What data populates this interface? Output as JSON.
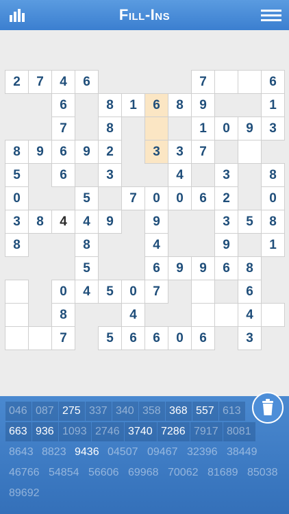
{
  "header": {
    "title": "Fill-Ins",
    "stats_icon": "bar-chart-icon",
    "menu_icon": "hamburger-menu-icon"
  },
  "colors": {
    "header": "#3b7fd0",
    "tray": "#3a79c4",
    "digit": "#1f4e7a",
    "highlight": "#fbe6c4"
  },
  "grid": {
    "rows": 12,
    "cols": 12,
    "cells": [
      {
        "r": 0,
        "c": 0,
        "v": "2"
      },
      {
        "r": 0,
        "c": 1,
        "v": "7"
      },
      {
        "r": 0,
        "c": 2,
        "v": "4"
      },
      {
        "r": 0,
        "c": 3,
        "v": "6"
      },
      {
        "r": 0,
        "c": 8,
        "v": "7"
      },
      {
        "r": 0,
        "c": 9,
        "v": ""
      },
      {
        "r": 0,
        "c": 10,
        "v": ""
      },
      {
        "r": 0,
        "c": 11,
        "v": "6"
      },
      {
        "r": 1,
        "c": 2,
        "v": "6"
      },
      {
        "r": 1,
        "c": 4,
        "v": "8"
      },
      {
        "r": 1,
        "c": 5,
        "v": "1"
      },
      {
        "r": 1,
        "c": 6,
        "v": "6",
        "hl": true
      },
      {
        "r": 1,
        "c": 7,
        "v": "8"
      },
      {
        "r": 1,
        "c": 8,
        "v": "9"
      },
      {
        "r": 1,
        "c": 11,
        "v": "1"
      },
      {
        "r": 2,
        "c": 2,
        "v": "7"
      },
      {
        "r": 2,
        "c": 4,
        "v": "8"
      },
      {
        "r": 2,
        "c": 6,
        "v": "",
        "hl": true
      },
      {
        "r": 2,
        "c": 8,
        "v": "1"
      },
      {
        "r": 2,
        "c": 9,
        "v": "0"
      },
      {
        "r": 2,
        "c": 10,
        "v": "9"
      },
      {
        "r": 2,
        "c": 11,
        "v": "3"
      },
      {
        "r": 3,
        "c": 0,
        "v": "8"
      },
      {
        "r": 3,
        "c": 1,
        "v": "9"
      },
      {
        "r": 3,
        "c": 2,
        "v": "6"
      },
      {
        "r": 3,
        "c": 3,
        "v": "9"
      },
      {
        "r": 3,
        "c": 4,
        "v": "2"
      },
      {
        "r": 3,
        "c": 6,
        "v": "3",
        "hl": true
      },
      {
        "r": 3,
        "c": 7,
        "v": "3"
      },
      {
        "r": 3,
        "c": 8,
        "v": "7"
      },
      {
        "r": 3,
        "c": 10,
        "v": ""
      },
      {
        "r": 4,
        "c": 0,
        "v": "5"
      },
      {
        "r": 4,
        "c": 2,
        "v": "6"
      },
      {
        "r": 4,
        "c": 4,
        "v": "3"
      },
      {
        "r": 4,
        "c": 7,
        "v": "4"
      },
      {
        "r": 4,
        "c": 9,
        "v": "3"
      },
      {
        "r": 4,
        "c": 11,
        "v": "8"
      },
      {
        "r": 5,
        "c": 0,
        "v": "0"
      },
      {
        "r": 5,
        "c": 3,
        "v": "5"
      },
      {
        "r": 5,
        "c": 5,
        "v": "7"
      },
      {
        "r": 5,
        "c": 6,
        "v": "0"
      },
      {
        "r": 5,
        "c": 7,
        "v": "0"
      },
      {
        "r": 5,
        "c": 8,
        "v": "6"
      },
      {
        "r": 5,
        "c": 9,
        "v": "2"
      },
      {
        "r": 5,
        "c": 11,
        "v": "0"
      },
      {
        "r": 6,
        "c": 0,
        "v": "3"
      },
      {
        "r": 6,
        "c": 1,
        "v": "8"
      },
      {
        "r": 6,
        "c": 2,
        "v": "4",
        "given": true
      },
      {
        "r": 6,
        "c": 3,
        "v": "4"
      },
      {
        "r": 6,
        "c": 4,
        "v": "9"
      },
      {
        "r": 6,
        "c": 6,
        "v": "9"
      },
      {
        "r": 6,
        "c": 9,
        "v": "3"
      },
      {
        "r": 6,
        "c": 10,
        "v": "5"
      },
      {
        "r": 6,
        "c": 11,
        "v": "8"
      },
      {
        "r": 7,
        "c": 0,
        "v": "8"
      },
      {
        "r": 7,
        "c": 3,
        "v": "8"
      },
      {
        "r": 7,
        "c": 6,
        "v": "4"
      },
      {
        "r": 7,
        "c": 9,
        "v": "9"
      },
      {
        "r": 7,
        "c": 11,
        "v": "1"
      },
      {
        "r": 8,
        "c": 3,
        "v": "5"
      },
      {
        "r": 8,
        "c": 6,
        "v": "6"
      },
      {
        "r": 8,
        "c": 7,
        "v": "9"
      },
      {
        "r": 8,
        "c": 8,
        "v": "9"
      },
      {
        "r": 8,
        "c": 9,
        "v": "6"
      },
      {
        "r": 8,
        "c": 10,
        "v": "8"
      },
      {
        "r": 9,
        "c": 0,
        "v": ""
      },
      {
        "r": 9,
        "c": 2,
        "v": "0"
      },
      {
        "r": 9,
        "c": 3,
        "v": "4"
      },
      {
        "r": 9,
        "c": 4,
        "v": "5"
      },
      {
        "r": 9,
        "c": 5,
        "v": "0"
      },
      {
        "r": 9,
        "c": 6,
        "v": "7"
      },
      {
        "r": 9,
        "c": 8,
        "v": ""
      },
      {
        "r": 9,
        "c": 10,
        "v": "6"
      },
      {
        "r": 10,
        "c": 0,
        "v": ""
      },
      {
        "r": 10,
        "c": 2,
        "v": "8"
      },
      {
        "r": 10,
        "c": 5,
        "v": "4"
      },
      {
        "r": 10,
        "c": 8,
        "v": ""
      },
      {
        "r": 10,
        "c": 9,
        "v": ""
      },
      {
        "r": 10,
        "c": 10,
        "v": "4"
      },
      {
        "r": 10,
        "c": 11,
        "v": ""
      },
      {
        "r": 11,
        "c": 0,
        "v": ""
      },
      {
        "r": 11,
        "c": 1,
        "v": ""
      },
      {
        "r": 11,
        "c": 2,
        "v": "7"
      },
      {
        "r": 11,
        "c": 4,
        "v": "5"
      },
      {
        "r": 11,
        "c": 5,
        "v": "6"
      },
      {
        "r": 11,
        "c": 6,
        "v": "6"
      },
      {
        "r": 11,
        "c": 7,
        "v": "0"
      },
      {
        "r": 11,
        "c": 8,
        "v": "6"
      },
      {
        "r": 11,
        "c": 10,
        "v": "3"
      }
    ]
  },
  "word_bank": {
    "rows": [
      [
        {
          "t": "046"
        },
        {
          "t": "087"
        },
        {
          "t": "275",
          "active": true
        },
        {
          "t": "337"
        },
        {
          "t": "340"
        },
        {
          "t": "358"
        },
        {
          "t": "368",
          "active": true
        },
        {
          "t": "557",
          "active": true
        },
        {
          "t": "613"
        }
      ],
      [
        {
          "t": "663",
          "active": true
        },
        {
          "t": "936",
          "active": true
        },
        {
          "t": "1093"
        },
        {
          "t": "2746"
        },
        {
          "t": "3740",
          "active": true
        },
        {
          "t": "7286",
          "active": true
        },
        {
          "t": "7917"
        },
        {
          "t": "8081"
        }
      ],
      [
        {
          "t": "8643"
        },
        {
          "t": "8823"
        },
        {
          "t": "9436",
          "active": true
        },
        {
          "t": "04507"
        },
        {
          "t": "09467"
        },
        {
          "t": "32396"
        },
        {
          "t": "38449"
        }
      ],
      [
        {
          "t": "46766"
        },
        {
          "t": "54854"
        },
        {
          "t": "56606"
        },
        {
          "t": "69968"
        },
        {
          "t": "70062"
        },
        {
          "t": "81689"
        },
        {
          "t": "85038"
        }
      ],
      [
        {
          "t": "89692"
        }
      ]
    ],
    "trash_icon": "trash-can-icon"
  }
}
